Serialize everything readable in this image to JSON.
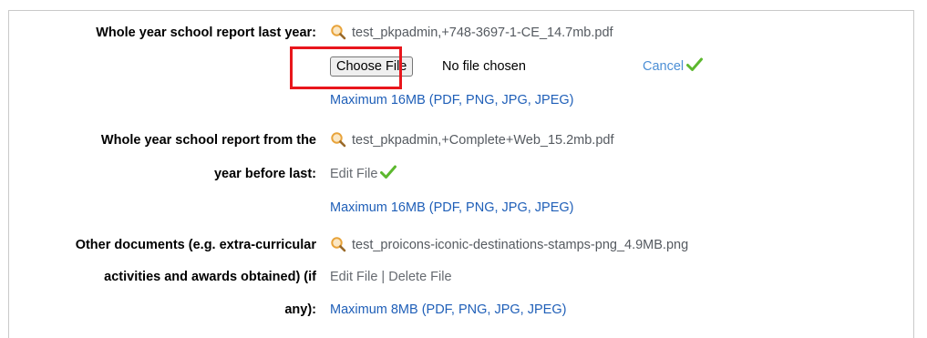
{
  "fields": [
    {
      "label": "Whole year school report last year:",
      "file_name": "test_pkpadmin,+748-3697-1-CE_14.7mb.pdf",
      "choose_button": "Choose File",
      "no_file_text": "No file chosen",
      "cancel": "Cancel",
      "max_note": "Maximum 16MB (PDF, PNG, JPG, JPEG)"
    },
    {
      "label_line1": "Whole year school report from the",
      "label_line2": "year before last:",
      "file_name": "test_pkpadmin,+Complete+Web_15.2mb.pdf",
      "edit": "Edit File",
      "max_note": "Maximum 16MB (PDF, PNG, JPG, JPEG)"
    },
    {
      "label_line1": "Other documents (e.g. extra-curricular",
      "label_line2": "activities and awards obtained) (if",
      "label_line3": "any):",
      "file_name": "test_proicons-iconic-destinations-stamps-png_4.9MB.png",
      "edit": "Edit File",
      "separator": "|",
      "delete": "Delete File",
      "max_note": "Maximum 8MB (PDF, PNG, JPG, JPEG)"
    }
  ],
  "icons": {
    "view": "magnifier-icon",
    "done": "checkmark-icon"
  },
  "colors": {
    "label": "#000000",
    "link_blue": "#1f5fb8",
    "cancel_blue": "#4c8fd6",
    "check_green": "#5cb82e",
    "magnifier_orange": "#e8a33a",
    "highlight_red": "#e8161c"
  }
}
